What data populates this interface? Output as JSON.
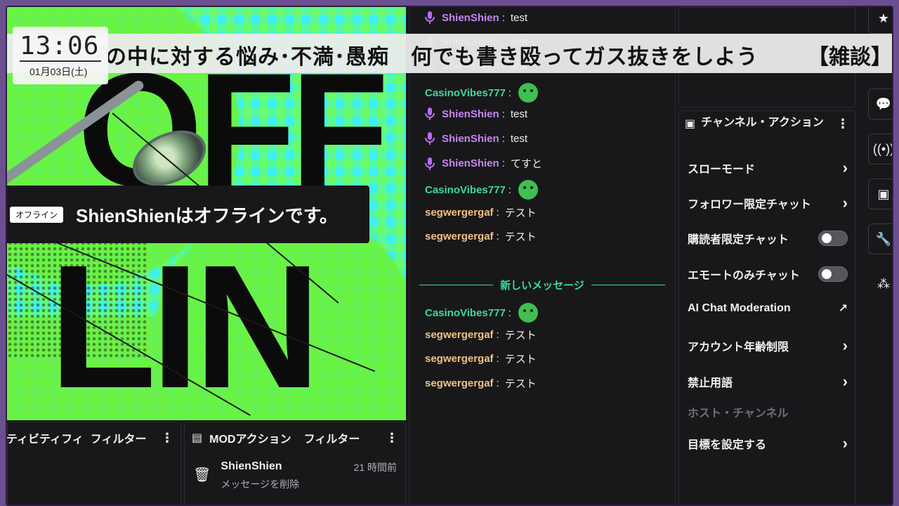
{
  "overlay": {
    "clock_time": "13:06",
    "clock_date": "01月03日(土)",
    "ticker_text": "の中に対する悩み･不満･愚痴　何でも書き殴ってガス抜きをしよう",
    "ticker_text_repeat": "【雑談】世の"
  },
  "video": {
    "offline_badge": "オフライン",
    "offline_message": "ShienShienはオフラインです。",
    "bg_top": "OFF",
    "bg_bottom": "LIN"
  },
  "activity_panel": {
    "title": "ティビティフィ",
    "filter_label": "フィルター"
  },
  "mod_panel": {
    "title": "MODアクション",
    "filter_label": "フィルター",
    "entry": {
      "user": "ShienShien",
      "action": "メッセージを削除",
      "time": "21 時間前"
    }
  },
  "chat": {
    "messages": [
      {
        "user": "ShienShien",
        "text": "test",
        "type": "shien"
      },
      {
        "user": "ShienShien",
        "text": "test",
        "type": "shien"
      },
      {
        "user": "ShienShien",
        "text": "test",
        "type": "shien"
      },
      {
        "user": "CasinoVibes777",
        "text": "",
        "type": "casino"
      },
      {
        "user": "ShienShien",
        "text": "test",
        "type": "shien"
      },
      {
        "user": "ShienShien",
        "text": "test",
        "type": "shien"
      },
      {
        "user": "ShienShien",
        "text": "てすと",
        "type": "shien"
      },
      {
        "user": "CasinoVibes777",
        "text": "",
        "type": "casino"
      },
      {
        "user": "segwergergaf",
        "text": "テスト",
        "type": "seg"
      },
      {
        "user": "segwergergaf",
        "text": "テスト",
        "type": "seg"
      },
      {
        "user": "CasinoVibes777",
        "text": "",
        "type": "casino"
      },
      {
        "user": "segwergergaf",
        "text": "テスト",
        "type": "seg"
      },
      {
        "user": "segwergergaf",
        "text": "テスト",
        "type": "seg"
      },
      {
        "user": "segwergergaf",
        "text": "テスト",
        "type": "seg"
      }
    ],
    "new_messages_divider": "新しいメッセージ"
  },
  "channel_actions": {
    "title": "チャンネル・アクション",
    "items": [
      {
        "label": "スローモード",
        "control": "chevron"
      },
      {
        "label": "フォロワー限定チャット",
        "control": "chevron"
      },
      {
        "label": "購読者限定チャット",
        "control": "toggle"
      },
      {
        "label": "エモートのみチャット",
        "control": "toggle"
      },
      {
        "label": "AI Chat Moderation",
        "control": "external"
      },
      {
        "label": "アカウント年齢制限",
        "control": "chevron"
      },
      {
        "label": "禁止用語",
        "control": "chevron"
      },
      {
        "label": "ホスト・チャンネル",
        "control": "disabled"
      },
      {
        "label": "目標を設定する",
        "control": "chevron"
      }
    ]
  },
  "colors": {
    "shien": "#c883f2",
    "casino": "#3dd9a0",
    "seg": "#f2c283",
    "background": "#18181b"
  }
}
